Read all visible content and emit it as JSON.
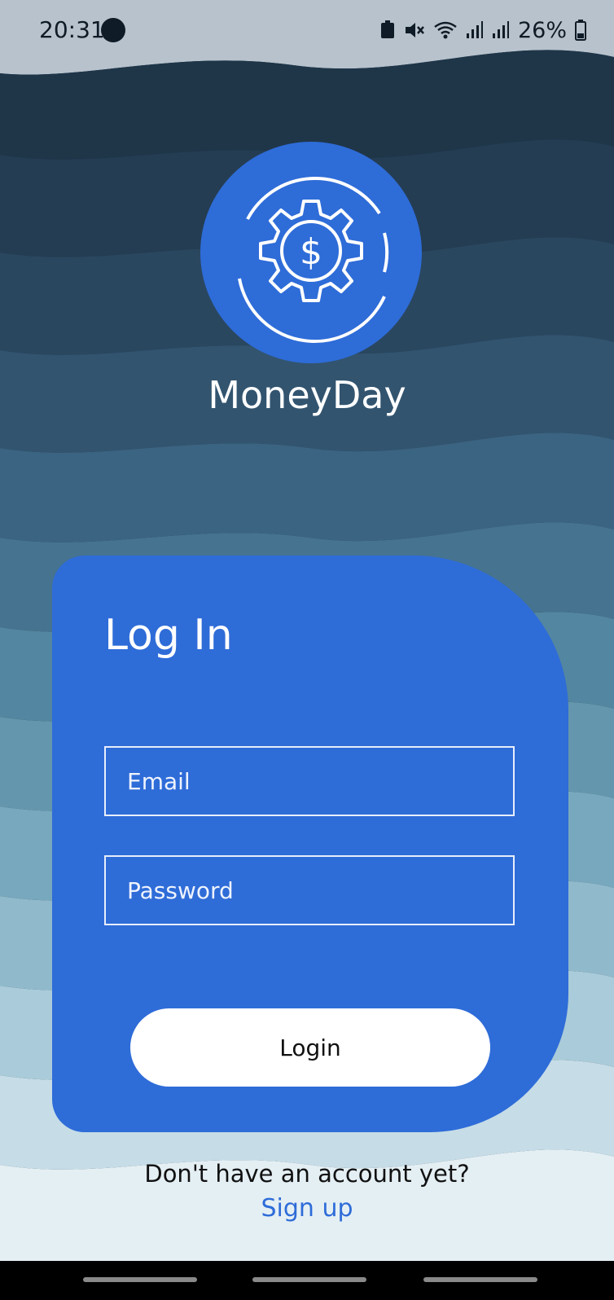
{
  "status_bar": {
    "time": "20:31",
    "battery": "26%"
  },
  "app": {
    "name": "MoneyDay",
    "logo_icon": "dollar-gear-icon"
  },
  "login": {
    "title": "Log In",
    "email_placeholder": "Email",
    "password_placeholder": "Password",
    "button_label": "Login"
  },
  "signup": {
    "prompt": "Don't have an account yet?",
    "link_label": "Sign up"
  },
  "colors": {
    "accent": "#2e6cd8",
    "card": "#2e6cd8",
    "button_bg": "#ffffff"
  }
}
